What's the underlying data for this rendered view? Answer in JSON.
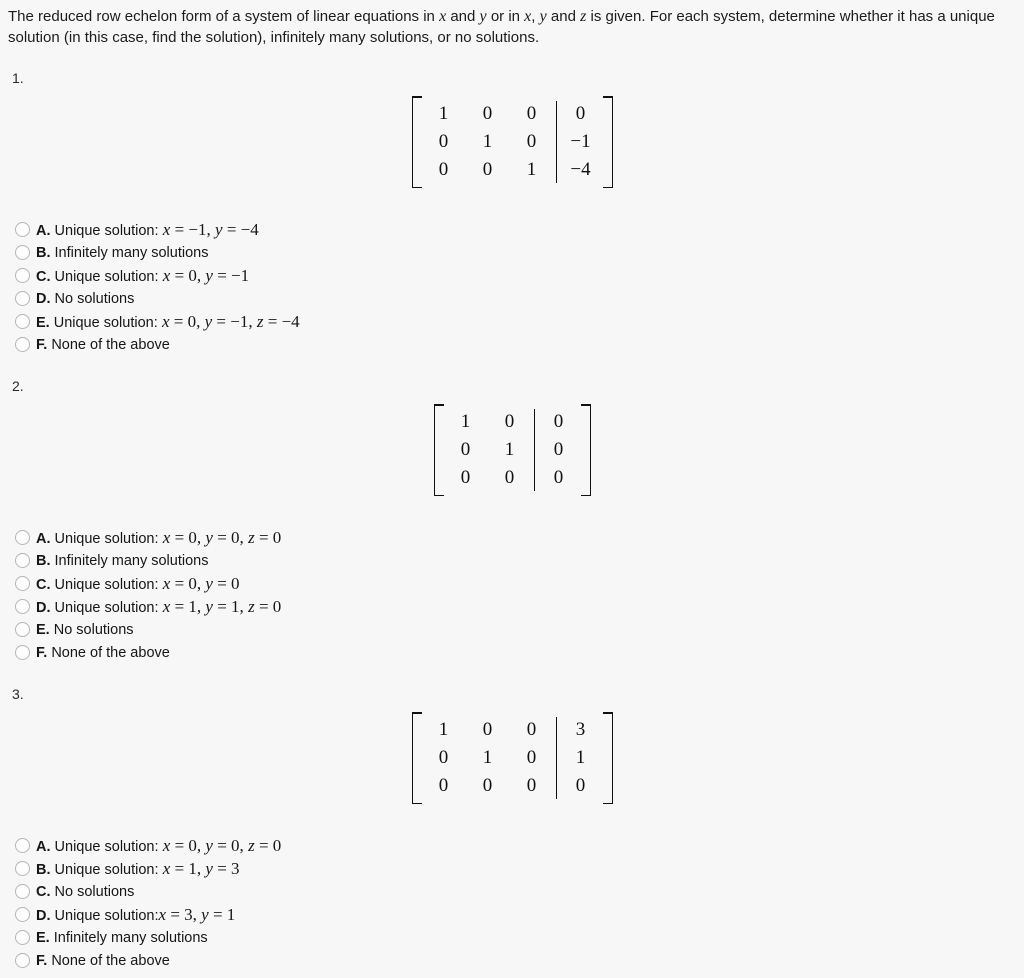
{
  "prompt": {
    "part1": "The reduced row echelon form of a system of linear equations in ",
    "v1": "x",
    "part2": " and ",
    "v2": "y",
    "part3": " or in ",
    "v3": "x",
    "part4": ", ",
    "v4": "y",
    "part5": " and ",
    "v5": "z",
    "part6": " is given. For each system, determine whether it has a unique solution (in this case, find the solution), infinitely many solutions, or no solutions."
  },
  "questions": [
    {
      "number": "1.",
      "matrix": {
        "coefficients": [
          [
            "1",
            "0",
            "0"
          ],
          [
            "0",
            "1",
            "0"
          ],
          [
            "0",
            "0",
            "1"
          ]
        ],
        "constants": [
          [
            "0"
          ],
          [
            "−1"
          ],
          [
            "−4"
          ]
        ]
      },
      "options": [
        {
          "letter": "A.",
          "text": "Unique solution: x = −1, y = −4"
        },
        {
          "letter": "B.",
          "text": "Infinitely many solutions"
        },
        {
          "letter": "C.",
          "text": "Unique solution: x = 0, y = −1"
        },
        {
          "letter": "D.",
          "text": "No solutions"
        },
        {
          "letter": "E.",
          "text": "Unique solution: x = 0, y = −1, z = −4"
        },
        {
          "letter": "F.",
          "text": "None of the above"
        }
      ]
    },
    {
      "number": "2.",
      "matrix": {
        "coefficients": [
          [
            "1",
            "0"
          ],
          [
            "0",
            "1"
          ],
          [
            "0",
            "0"
          ]
        ],
        "constants": [
          [
            "0"
          ],
          [
            "0"
          ],
          [
            "0"
          ]
        ]
      },
      "options": [
        {
          "letter": "A.",
          "text": "Unique solution: x = 0, y = 0, z = 0"
        },
        {
          "letter": "B.",
          "text": "Infinitely many solutions"
        },
        {
          "letter": "C.",
          "text": "Unique solution: x = 0, y = 0"
        },
        {
          "letter": "D.",
          "text": "Unique solution: x = 1, y = 1, z = 0"
        },
        {
          "letter": "E.",
          "text": "No solutions"
        },
        {
          "letter": "F.",
          "text": "None of the above"
        }
      ]
    },
    {
      "number": "3.",
      "matrix": {
        "coefficients": [
          [
            "1",
            "0",
            "0"
          ],
          [
            "0",
            "1",
            "0"
          ],
          [
            "0",
            "0",
            "0"
          ]
        ],
        "constants": [
          [
            "3"
          ],
          [
            "1"
          ],
          [
            "0"
          ]
        ]
      },
      "options": [
        {
          "letter": "A.",
          "text": "Unique solution: x = 0, y = 0, z = 0"
        },
        {
          "letter": "B.",
          "text": "Unique solution: x = 1, y = 3"
        },
        {
          "letter": "C.",
          "text": "No solutions"
        },
        {
          "letter": "D.",
          "text": "Unique solution:x = 3, y = 1"
        },
        {
          "letter": "E.",
          "text": "Infinitely many solutions"
        },
        {
          "letter": "F.",
          "text": "None of the above"
        }
      ]
    }
  ],
  "colors": {
    "background": "#f7f7f7",
    "text": "#1a1a1a",
    "radio_border": "#b5b5b5"
  }
}
